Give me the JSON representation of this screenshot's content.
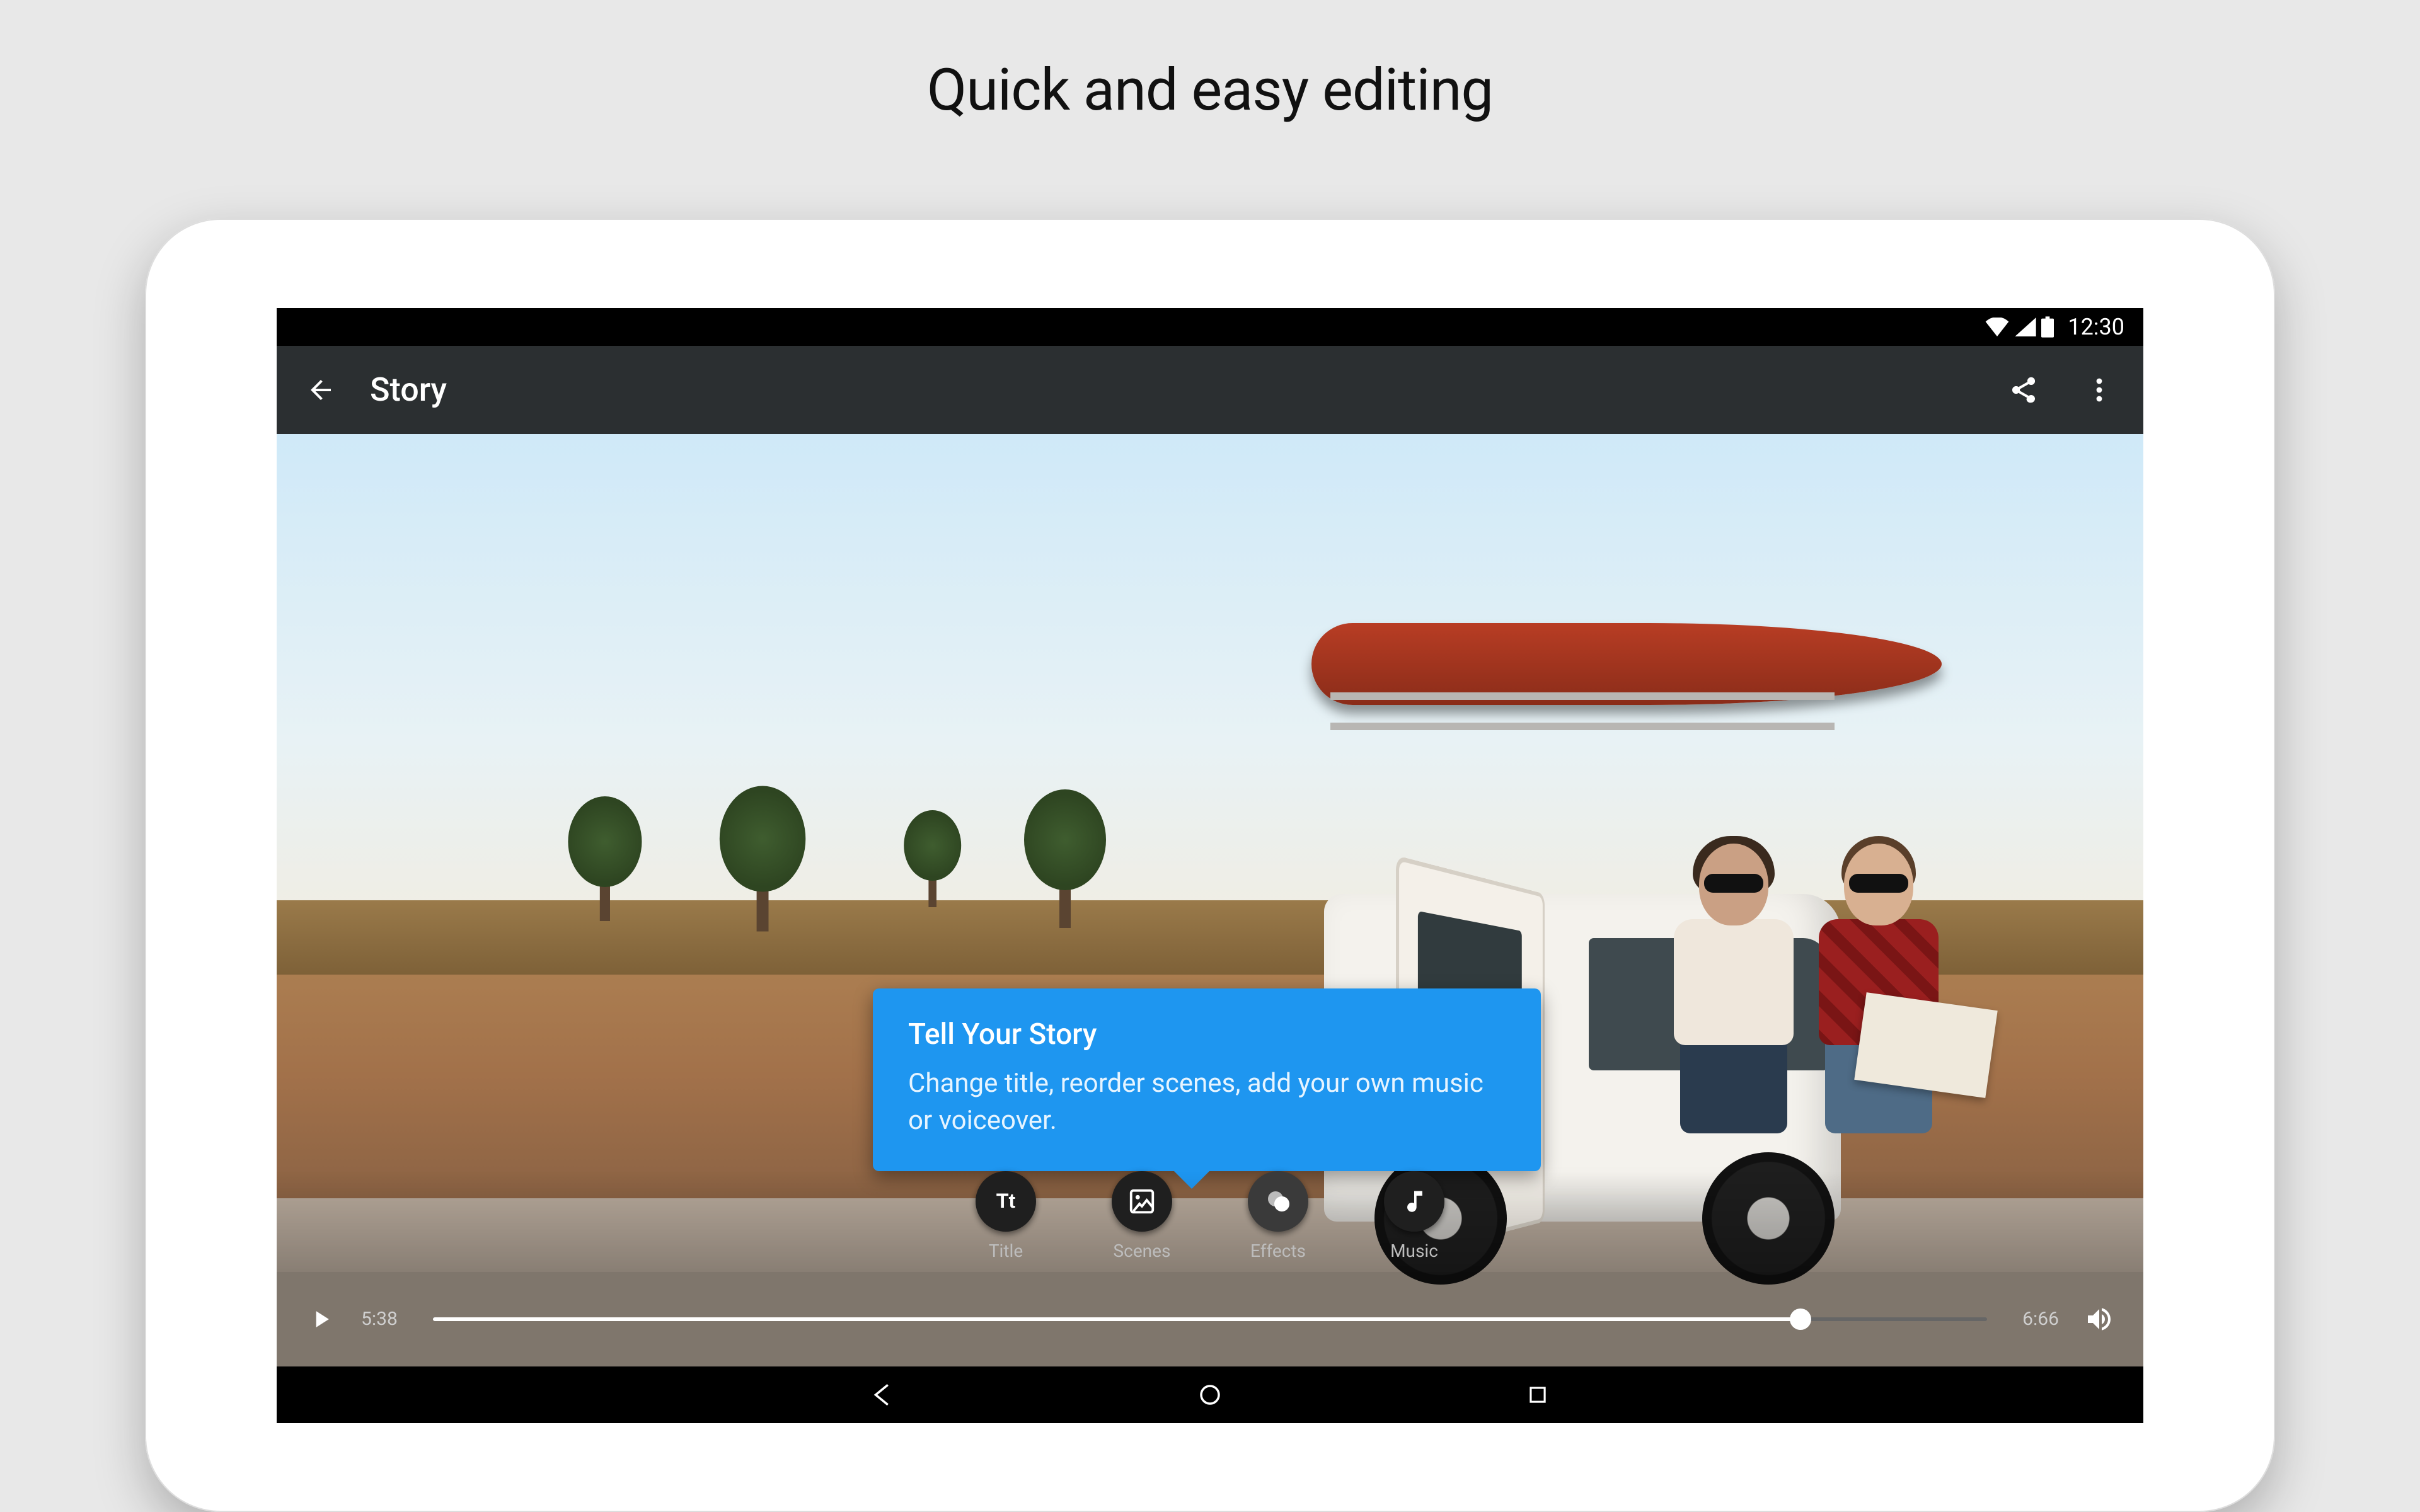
{
  "headline": "Quick and easy editing",
  "statusbar": {
    "time": "12:30"
  },
  "appbar": {
    "title": "Story"
  },
  "tooltip": {
    "title": "Tell Your Story",
    "body": "Change title, reorder scenes, add your own music or voiceover."
  },
  "tools": {
    "title": {
      "label": "Title"
    },
    "scenes": {
      "label": "Scenes"
    },
    "effects": {
      "label": "Effects"
    },
    "music": {
      "label": "Music"
    }
  },
  "playbar": {
    "current": "5:38",
    "total": "6:66"
  }
}
